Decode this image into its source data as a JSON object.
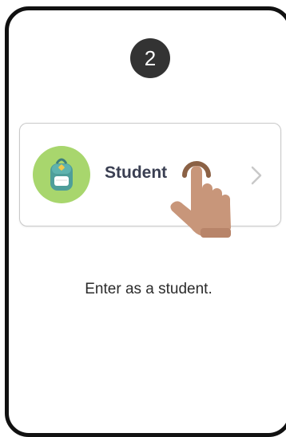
{
  "step": {
    "number": "2"
  },
  "role_card": {
    "label": "Student",
    "avatar_icon": "backpack-icon",
    "chevron_icon": "chevron-right-icon"
  },
  "pointer": {
    "icon": "tap-hand-icon"
  },
  "description": {
    "text": "Enter as a student."
  },
  "colors": {
    "badge": "#333333",
    "avatar_bg": "#a8d66d",
    "backpack": "#4e9e9a",
    "label": "#3a3f52",
    "hand": "#c8967a"
  }
}
